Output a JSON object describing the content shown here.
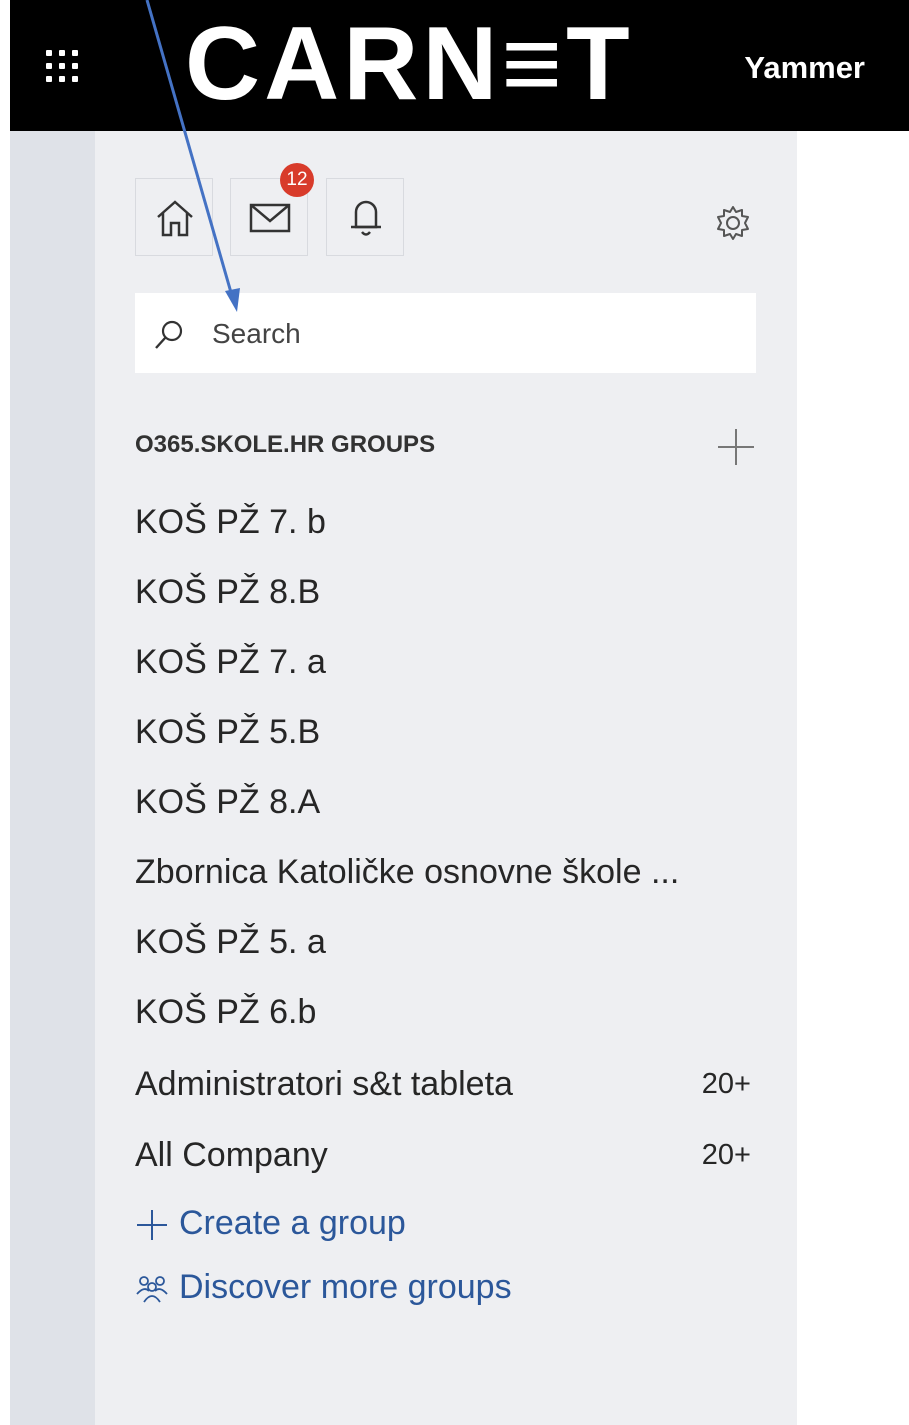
{
  "header": {
    "logo": "CARN≡T",
    "app_name": "Yammer"
  },
  "nav": {
    "home_icon": "home-icon",
    "inbox_icon": "mail-icon",
    "inbox_badge": "12",
    "notifications_icon": "bell-icon",
    "settings_icon": "gear-icon"
  },
  "search": {
    "placeholder": "Search"
  },
  "groups": {
    "header": "O365.SKOLE.HR GROUPS",
    "items": [
      {
        "name": "KOŠ PŽ 7. b",
        "count": ""
      },
      {
        "name": "KOŠ PŽ 8.B",
        "count": ""
      },
      {
        "name": "KOŠ PŽ 7. a",
        "count": ""
      },
      {
        "name": "KOŠ PŽ 5.B",
        "count": ""
      },
      {
        "name": "KOŠ PŽ 8.A",
        "count": ""
      },
      {
        "name": "Zbornica Katoličke osnovne škole ...",
        "count": ""
      },
      {
        "name": "KOŠ PŽ 5. a",
        "count": ""
      },
      {
        "name": "KOŠ PŽ 6.b",
        "count": ""
      },
      {
        "name": "Administratori s&t tableta",
        "count": "20+"
      },
      {
        "name": "All Company",
        "count": "20+"
      }
    ],
    "create_label": "Create a group",
    "discover_label": "Discover more groups"
  },
  "colors": {
    "topbar": "#000000",
    "panel": "#eeeff2",
    "rail": "#dfe2e8",
    "badge": "#d83b2b",
    "link": "#2b579a",
    "annotation_arrow": "#4472c4"
  }
}
